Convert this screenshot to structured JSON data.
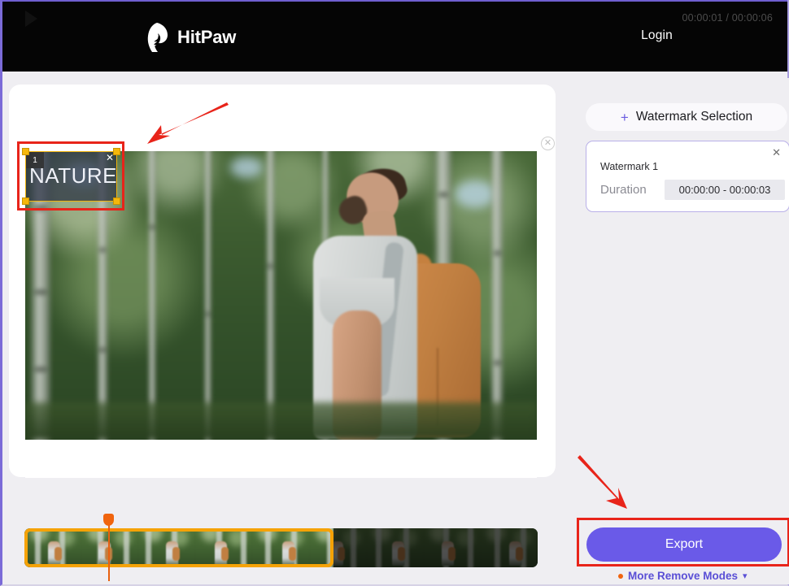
{
  "app": {
    "brand": "HitPaw",
    "logo_icon": "hitpaw-paw-logo-icon",
    "login_label": "Login"
  },
  "editor": {
    "close_icon": "close-circle-icon",
    "watermark_overlay": {
      "index_label": "1",
      "text": "NATURE",
      "remove_icon": "close-icon",
      "handle_icon": "resize-handle-icon"
    },
    "player": {
      "play_icon": "play-icon",
      "current_time": "00:00:01",
      "total_time": "00:00:06",
      "time_display": "00:00:01 / 00:00:06"
    },
    "timeline": {
      "playhead_icon": "playhead-marker-icon",
      "selection_border_color": "#f5a206",
      "frame_count": 9,
      "selected_frames": 5
    }
  },
  "sidebar": {
    "watermark_selection_button": {
      "label": "Watermark Selection",
      "plus_icon": "plus-icon"
    },
    "watermark_card": {
      "title": "Watermark 1",
      "duration_label": "Duration",
      "duration_value": "00:00:00 - 00:00:03",
      "close_icon": "close-icon",
      "border_color": "#b9b0e8"
    },
    "export_button": {
      "label": "Export",
      "color": "#6a5ae8"
    },
    "more_modes": {
      "label": "More Remove Modes",
      "dot_color": "#f0640e",
      "chevron_icon": "chevron-down-icon",
      "text_color": "#5a4fd6"
    }
  },
  "annotations": {
    "arrow_color": "#e8241a",
    "highlight_color": "#e8241a",
    "arrow_top_target": "watermark-overlay",
    "arrow_bottom_target": "export-button"
  }
}
